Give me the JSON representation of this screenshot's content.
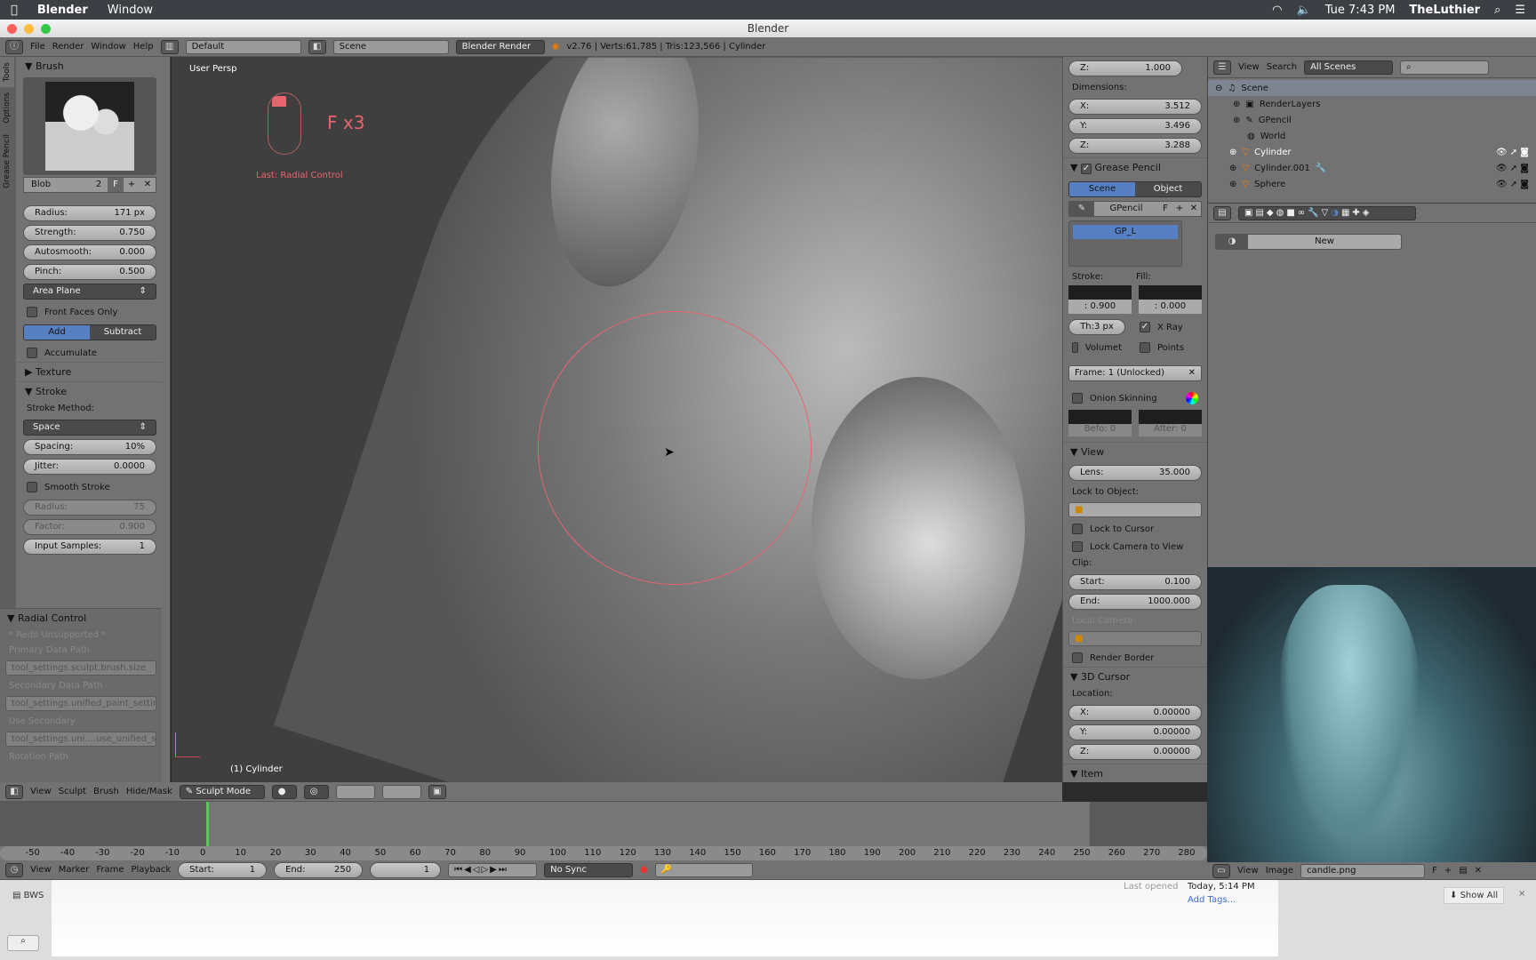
{
  "macbar": {
    "app": "Blender",
    "menu": "Window",
    "clock": "Tue 7:43 PM",
    "user": "TheLuthier"
  },
  "window": {
    "title": "Blender"
  },
  "info": {
    "menus": [
      "File",
      "Render",
      "Window",
      "Help"
    ],
    "layout": "Default",
    "scene": "Scene",
    "engine": "Blender Render",
    "stats": "v2.76 | Verts:61,785 | Tris:123,566 | Cylinder"
  },
  "toolshelf": {
    "tabs": [
      "Tools",
      "Options",
      "Grease Pencil"
    ],
    "brush_title": "Brush",
    "brush_name": "Blob",
    "brush_users": "2",
    "fake": "F",
    "radius": {
      "label": "Radius:",
      "value": "171 px"
    },
    "strength": {
      "label": "Strength:",
      "value": "0.750"
    },
    "autosmooth": {
      "label": "Autosmooth:",
      "value": "0.000"
    },
    "pinch": {
      "label": "Pinch:",
      "value": "0.500"
    },
    "plane": "Area Plane",
    "front_faces": "Front Faces Only",
    "add": "Add",
    "subtract": "Subtract",
    "accumulate": "Accumulate",
    "texture": "Texture",
    "stroke": "Stroke",
    "stroke_method_label": "Stroke Method:",
    "stroke_method": "Space",
    "spacing": {
      "label": "Spacing:",
      "value": "10%"
    },
    "jitter": {
      "label": "Jitter:",
      "value": "0.0000"
    },
    "smooth_stroke": "Smooth Stroke",
    "ss_radius": {
      "label": "Radius:",
      "value": "75"
    },
    "ss_factor": {
      "label": "Factor:",
      "value": "0.900"
    },
    "input_samples": {
      "label": "Input Samples:",
      "value": "1"
    }
  },
  "radial": {
    "title": "Radial Control",
    "redo": "* Redo Unsupported *",
    "primary_label": "Primary Data Path",
    "primary": "tool_settings.sculpt.brush.size",
    "secondary_label": "Secondary Data Path",
    "secondary": "tool_settings.unified_paint_settin...",
    "use_secondary_label": "Use Secondary",
    "use_secondary": "tool_settings.uni....use_unified_size",
    "rotation_label": "Rotation Path"
  },
  "viewport": {
    "view_name": "User Persp",
    "key_overlay": "F x3",
    "last_op": "Last: Radial Control",
    "object": "(1) Cylinder",
    "brush_color": "#e8646e"
  },
  "npanel": {
    "scale_z": {
      "label": "Z:",
      "value": "1.000"
    },
    "dimensions_label": "Dimensions:",
    "dims": [
      {
        "label": "X:",
        "value": "3.512"
      },
      {
        "label": "Y:",
        "value": "3.496"
      },
      {
        "label": "Z:",
        "value": "3.288"
      }
    ],
    "gp_title": "Grease Pencil",
    "gp_scene": "Scene",
    "gp_object": "Object",
    "gp_name": "GPencil",
    "gp_f": "F",
    "gp_layer": "GP_L",
    "stroke_label": "Stroke:",
    "fill_label": "Fill:",
    "stroke_val": ": 0.900",
    "fill_val": ": 0.000",
    "thickness": "Th:3 px",
    "xray": "X Ray",
    "volumet": "Volumet",
    "points": "Points",
    "frame": "Frame: 1 (Unlocked)",
    "onion": "Onion Skinning",
    "before": "Befo: 0",
    "after": "After: 0",
    "view_title": "View",
    "lens": {
      "label": "Lens:",
      "value": "35.000"
    },
    "lock_obj": "Lock to Object:",
    "lock_cursor": "Lock to Cursor",
    "lock_cam": "Lock Camera to View",
    "clip": "Clip:",
    "clip_start": {
      "label": "Start:",
      "value": "0.100"
    },
    "clip_end": {
      "label": "End:",
      "value": "1000.000"
    },
    "local_cam": "Local Camera:",
    "render_border": "Render Border",
    "cursor_title": "3D Cursor",
    "location": "Location:",
    "loc": [
      {
        "label": "X:",
        "value": "0.00000"
      },
      {
        "label": "Y:",
        "value": "0.00000"
      },
      {
        "label": "Z:",
        "value": "0.00000"
      }
    ],
    "item_title": "Item"
  },
  "outliner": {
    "menus": [
      "View",
      "Search"
    ],
    "filter": "All Scenes",
    "items": [
      "Scene",
      "RenderLayers",
      "GPencil",
      "World",
      "Cylinder",
      "Cylinder.001",
      "Sphere"
    ]
  },
  "properties": {
    "new": "New"
  },
  "image_editor": {
    "menus": [
      "View",
      "Image"
    ],
    "image": "candle.png",
    "f": "F"
  },
  "header3d": {
    "menus": [
      "View",
      "Sculpt",
      "Brush",
      "Hide/Mask"
    ],
    "mode": "Sculpt Mode"
  },
  "timeline": {
    "ticks": [
      "-50",
      "-40",
      "-30",
      "-20",
      "-10",
      "0",
      "10",
      "20",
      "30",
      "40",
      "50",
      "60",
      "70",
      "80",
      "90",
      "100",
      "110",
      "120",
      "130",
      "140",
      "150",
      "160",
      "170",
      "180",
      "190",
      "200",
      "210",
      "220",
      "230",
      "240",
      "250",
      "260",
      "270",
      "280"
    ],
    "current_frame": 1,
    "menus": [
      "View",
      "Marker",
      "Frame",
      "Playback"
    ],
    "start": {
      "label": "Start:",
      "value": "1"
    },
    "end": {
      "label": "End:",
      "value": "250"
    },
    "frame": "1",
    "sync": "No Sync"
  },
  "finder": {
    "file": "BWS",
    "last_opened_label": "Last opened",
    "last_opened": "Today, 5:14 PM",
    "add_tags": "Add Tags...",
    "show_all": "Show All"
  }
}
